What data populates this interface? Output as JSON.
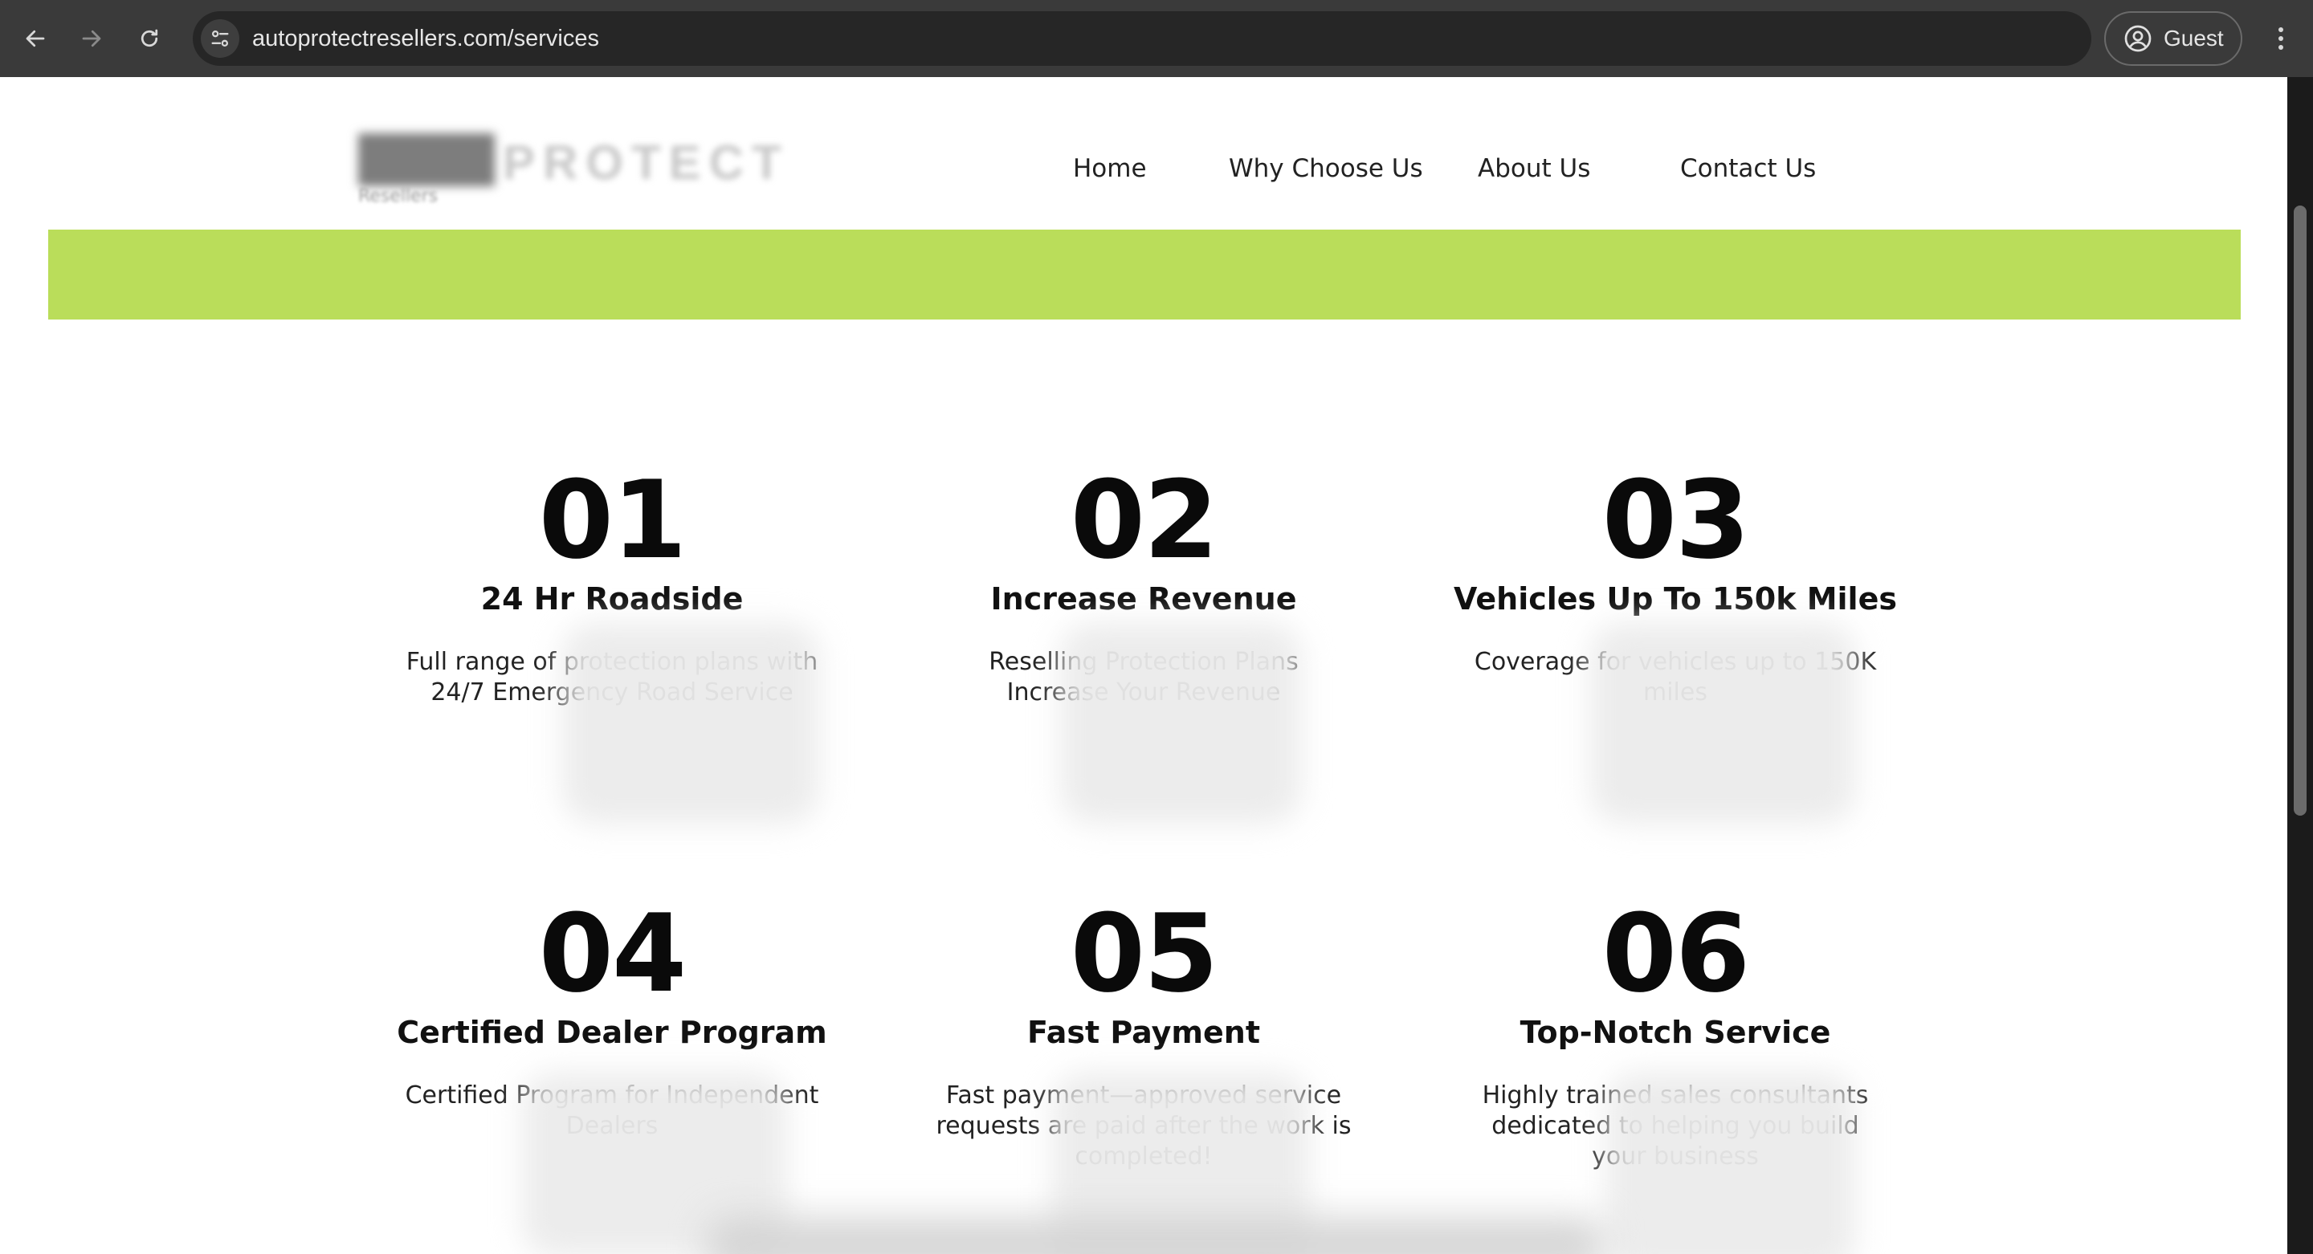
{
  "browser": {
    "url": "autoprotectresellers.com/services",
    "profile_label": "Guest"
  },
  "site": {
    "logo_text": "PROTECT",
    "logo_tagline": "Resellers",
    "nav": [
      {
        "label": "Home"
      },
      {
        "label": "Why Choose Us"
      },
      {
        "label": "About Us"
      },
      {
        "label": "Contact Us"
      }
    ],
    "band_color": "#badd5a"
  },
  "services": [
    {
      "number": "01",
      "title": "24 Hr Roadside",
      "description": "Full range of protection plans with 24/7 Emergency Road Service"
    },
    {
      "number": "02",
      "title": "Increase Revenue",
      "description": "Reselling Protection Plans Increase Your Revenue"
    },
    {
      "number": "03",
      "title": "Vehicles Up To 150k Miles",
      "description": "Coverage for vehicles up to 150K miles"
    },
    {
      "number": "04",
      "title": "Certified Dealer Program",
      "description": "Certified Program for Independent Dealers"
    },
    {
      "number": "05",
      "title": "Fast Payment",
      "description": "Fast payment—approved service requests are paid after the work is completed!"
    },
    {
      "number": "06",
      "title": "Top-Notch Service",
      "description": "Highly trained sales consultants dedicated to helping you build your business"
    }
  ]
}
